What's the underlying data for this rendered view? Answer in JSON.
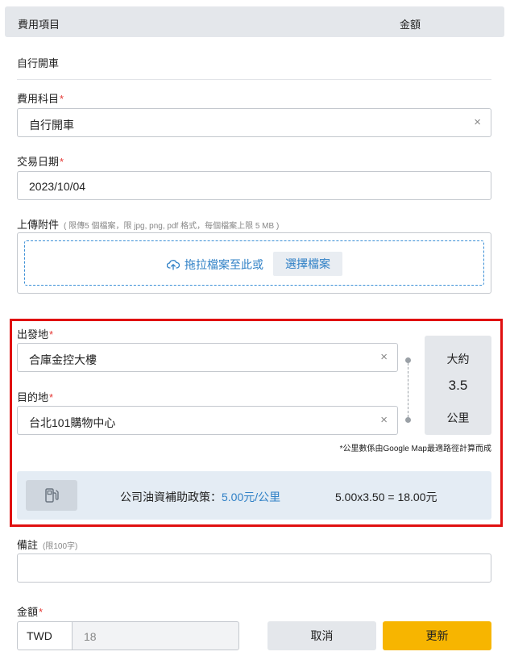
{
  "table_header": {
    "item": "費用項目",
    "amount": "金額"
  },
  "section_title": "自行開車",
  "expense_category": {
    "label": "費用科目",
    "required_mark": "*",
    "value": "自行開車",
    "clear_icon": "×"
  },
  "transaction_date": {
    "label": "交易日期",
    "required_mark": "*",
    "value": "2023/10/04"
  },
  "attachment": {
    "label": "上傳附件",
    "hint": "( 限傳5 個檔案，限 jpg, png, pdf 格式，每個檔案上限 5 MB )",
    "drop_text": "拖拉檔案至此或",
    "choose_button": "選擇檔案",
    "icon": "cloud-upload-icon"
  },
  "origin": {
    "label": "出發地",
    "required_mark": "*",
    "value": "合庫金控大樓",
    "clear_icon": "×"
  },
  "destination": {
    "label": "目的地",
    "required_mark": "*",
    "value": "台北101購物中心",
    "clear_icon": "×"
  },
  "distance": {
    "prefix": "大約",
    "value": "3.5",
    "unit": "公里"
  },
  "distance_note": "*公里數係由Google Map最適路徑計算而成",
  "policy": {
    "icon": "fuel-pump-icon",
    "label": "公司油資補助政策：",
    "rate": "5.00元/公里",
    "calculation": "5.00x3.50 = 18.00元"
  },
  "remarks": {
    "label": "備註",
    "hint": "(限100字)",
    "value": ""
  },
  "amount": {
    "label": "金額",
    "required_mark": "*",
    "currency": "TWD",
    "value": "18"
  },
  "buttons": {
    "cancel": "取消",
    "update": "更新"
  },
  "colors": {
    "accent_blue": "#2f80c6",
    "highlight_red": "#e01010",
    "primary_yellow": "#f7b500",
    "required_red": "#e53935"
  }
}
